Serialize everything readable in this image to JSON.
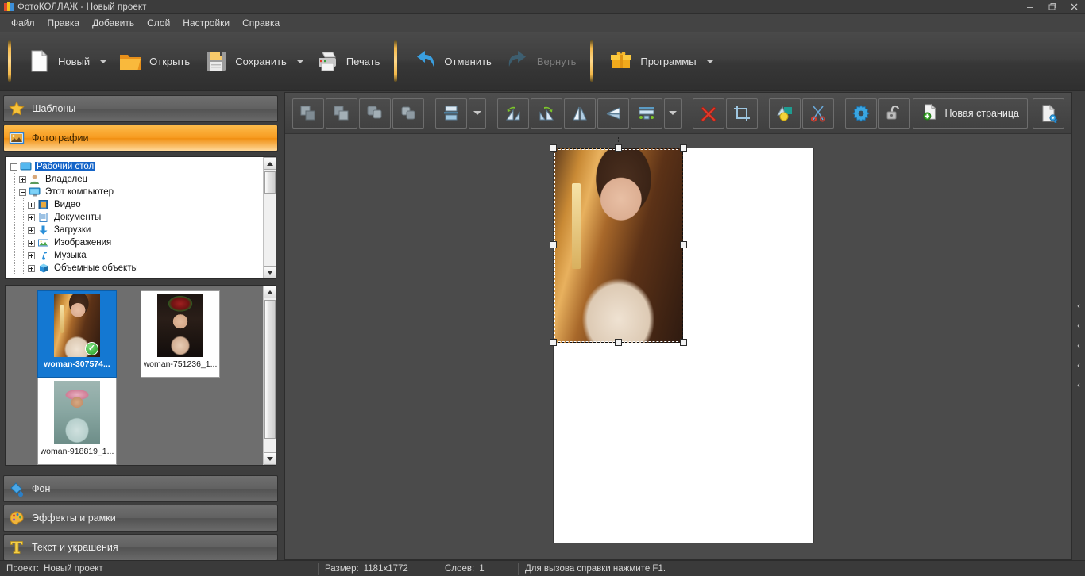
{
  "window": {
    "title": "ФотоКОЛЛАЖ - Новый проект",
    "app_icon": "photocollage-logo-icon",
    "minimize": "–",
    "restore": "❐",
    "close": "✕"
  },
  "menubar": {
    "items": [
      {
        "label": "Файл",
        "name": "menu-file"
      },
      {
        "label": "Правка",
        "name": "menu-edit"
      },
      {
        "label": "Добавить",
        "name": "menu-add"
      },
      {
        "label": "Слой",
        "name": "menu-layer"
      },
      {
        "label": "Настройки",
        "name": "menu-settings"
      },
      {
        "label": "Справка",
        "name": "menu-help"
      }
    ]
  },
  "toolbar": {
    "new": {
      "label": "Новый",
      "icon": "new-document-icon",
      "has_dropdown": true
    },
    "open": {
      "label": "Открыть",
      "icon": "open-folder-icon",
      "has_dropdown": false
    },
    "save": {
      "label": "Сохранить",
      "icon": "floppy-disk-icon",
      "has_dropdown": true
    },
    "print": {
      "label": "Печать",
      "icon": "printer-icon",
      "has_dropdown": false
    },
    "undo": {
      "label": "Отменить",
      "icon": "undo-arrow-icon",
      "enabled": true
    },
    "redo": {
      "label": "Вернуть",
      "icon": "redo-arrow-icon",
      "enabled": false
    },
    "programs": {
      "label": "Программы",
      "icon": "gift-box-icon",
      "has_dropdown": true
    }
  },
  "sidebar": {
    "panels": [
      {
        "label": "Шаблоны",
        "icon": "star-icon",
        "active": false
      },
      {
        "label": "Фотографии",
        "icon": "photo-icon",
        "active": true
      },
      {
        "label": "Фон",
        "icon": "paint-bucket-icon",
        "active": false
      },
      {
        "label": "Эффекты и рамки",
        "icon": "palette-icon",
        "active": false
      },
      {
        "label": "Текст и украшения",
        "icon": "text-t-icon",
        "active": false
      }
    ],
    "tree": [
      {
        "label": "Рабочий стол",
        "depth": 0,
        "expander": "minus",
        "icon": "desktop-icon",
        "selected": true
      },
      {
        "label": "Владелец",
        "depth": 1,
        "expander": "plus",
        "icon": "user-icon",
        "selected": false
      },
      {
        "label": "Этот компьютер",
        "depth": 1,
        "expander": "minus",
        "icon": "computer-icon",
        "selected": false
      },
      {
        "label": "Видео",
        "depth": 2,
        "expander": "plus",
        "icon": "video-folder-icon",
        "selected": false
      },
      {
        "label": "Документы",
        "depth": 2,
        "expander": "plus",
        "icon": "documents-folder-icon",
        "selected": false
      },
      {
        "label": "Загрузки",
        "depth": 2,
        "expander": "plus",
        "icon": "downloads-folder-icon",
        "selected": false
      },
      {
        "label": "Изображения",
        "depth": 2,
        "expander": "plus",
        "icon": "pictures-folder-icon",
        "selected": false
      },
      {
        "label": "Музыка",
        "depth": 2,
        "expander": "plus",
        "icon": "music-folder-icon",
        "selected": false
      },
      {
        "label": "Объемные объекты",
        "depth": 2,
        "expander": "plus",
        "icon": "3d-objects-folder-icon",
        "selected": false
      }
    ],
    "thumbnails": [
      {
        "caption": "woman-307574...",
        "selected": true,
        "checked": true,
        "photo": "ph-woman1"
      },
      {
        "caption": "woman-751236_1...",
        "selected": false,
        "checked": false,
        "photo": "ph-woman2"
      },
      {
        "caption": "woman-918819_1...",
        "selected": false,
        "checked": false,
        "photo": "ph-woman3"
      }
    ]
  },
  "canvas_toolbar": {
    "buttons": [
      {
        "name": "bring-to-front-button",
        "icon": "layer-front-icon",
        "enabled": false
      },
      {
        "name": "bring-forward-button",
        "icon": "layer-forward-icon",
        "enabled": false
      },
      {
        "name": "send-backward-button",
        "icon": "layer-backward-icon",
        "enabled": false
      },
      {
        "name": "send-to-back-button",
        "icon": "layer-back-icon",
        "enabled": false
      },
      {
        "name": "align-button",
        "icon": "align-icon",
        "enabled": true
      },
      {
        "name": "align-dropdown",
        "icon": "chevron-down-icon",
        "enabled": true
      },
      {
        "name": "rotate-left-button",
        "icon": "rotate-left-icon",
        "enabled": true
      },
      {
        "name": "rotate-right-button",
        "icon": "rotate-right-icon",
        "enabled": true
      },
      {
        "name": "flip-horizontal-button",
        "icon": "flip-horizontal-icon",
        "enabled": true
      },
      {
        "name": "flip-vertical-button",
        "icon": "flip-vertical-icon",
        "enabled": true
      },
      {
        "name": "distribute-button",
        "icon": "distribute-icon",
        "enabled": true
      },
      {
        "name": "distribute-dropdown",
        "icon": "chevron-down-icon",
        "enabled": true
      },
      {
        "name": "delete-button",
        "icon": "red-cross-icon",
        "enabled": true
      },
      {
        "name": "crop-button",
        "icon": "crop-icon",
        "enabled": true
      },
      {
        "name": "effects-button",
        "icon": "effects-icon",
        "enabled": true
      },
      {
        "name": "cutout-button",
        "icon": "scissors-icon",
        "enabled": true
      },
      {
        "name": "settings-button",
        "icon": "gear-icon",
        "enabled": true
      },
      {
        "name": "lock-button",
        "icon": "open-lock-icon",
        "enabled": true
      }
    ],
    "new_page": {
      "label": "Новая страница",
      "icon": "new-page-icon"
    },
    "page_settings": {
      "icon": "page-settings-icon"
    }
  },
  "canvas": {
    "selected_photo": "ph-woman1",
    "collapse_chevrons": [
      "‹",
      "‹",
      "‹",
      "‹",
      "‹"
    ]
  },
  "statusbar": {
    "project_label": "Проект:",
    "project_name": "Новый проект",
    "size_label": "Размер:",
    "size_value": "1181x1772",
    "layers_label": "Слоев:",
    "layers_value": "1",
    "hint": "Для вызова справки нажмите F1."
  },
  "colors": {
    "accent_orange": "#f79c21",
    "selection_blue": "#1478d2",
    "separator_gold": "#f3b84a"
  }
}
